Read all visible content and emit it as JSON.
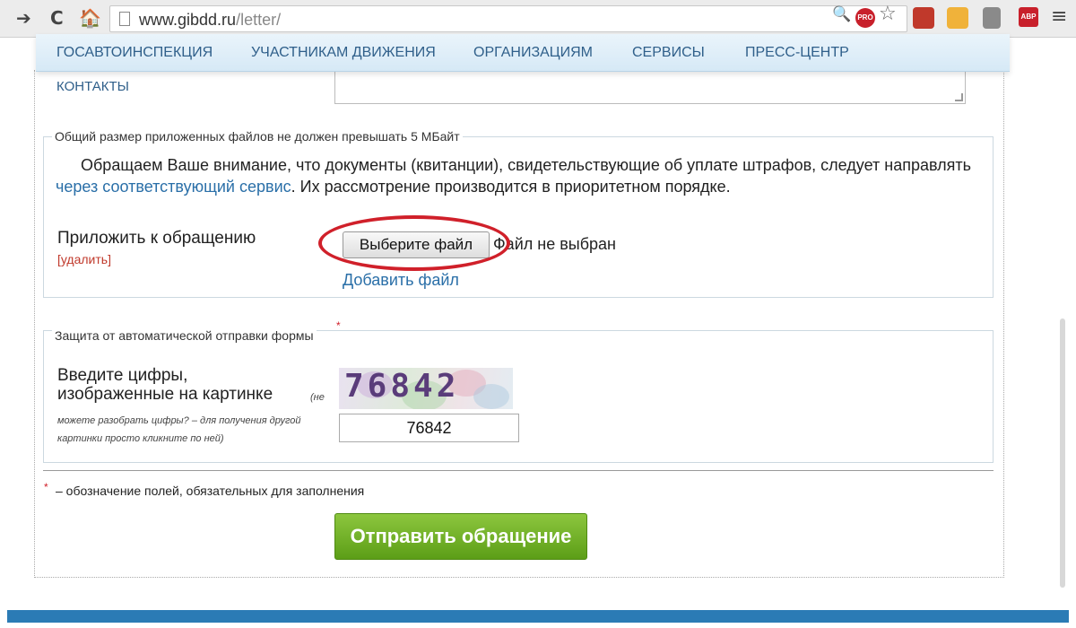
{
  "browser": {
    "back_glyph": "➔",
    "reload_glyph": "C",
    "home_glyph": "🏠",
    "url_host": "www.gibdd.ru",
    "url_path": "/letter/",
    "zoom_glyph": "🔍",
    "pro_badge": "PRO",
    "star_glyph": "☆",
    "abp_badge": "ABP",
    "menu_glyph": "≡"
  },
  "main_menu": {
    "items": [
      "ГОСАВТОИНСПЕКЦИЯ",
      "УЧАСТНИКАМ ДВИЖЕНИЯ",
      "ОРГАНИЗАЦИЯМ",
      "СЕРВИСЫ",
      "ПРЕСС-ЦЕНТР"
    ],
    "sub_item": "КОНТАКТЫ"
  },
  "attachments": {
    "legend": "Общий размер приложенных файлов не должен превышать 5 МБайт",
    "notice_before": "Обращаем Ваше внимание, что документы (квитанции), свидетельствующие об уплате штрафов, следует направлять ",
    "notice_link": "через соответствующий сервис",
    "notice_after": ". Их рассмотрение производится в приоритетном порядке.",
    "label": "Приложить к обращению",
    "delete_link": "[удалить]",
    "choose_button": "Выберите файл",
    "file_status": "Файл не выбран",
    "add_file_link": "Добавить файл"
  },
  "captcha": {
    "legend": "Защита от автоматической отправки формы",
    "required_star": "*",
    "label_line1": "Введите цифры,",
    "label_line2": "изображенные на картинке",
    "hint_inline": "(не",
    "hint": "можете разобрать цифры? – для получения другой картинки просто кликните по ней)",
    "image_digits": "76842",
    "input_value": "76842"
  },
  "footer": {
    "required_star": "*",
    "required_note": " – обозначение полей, обязательных для заполнения",
    "submit_label": "Отправить обращение"
  },
  "colors": {
    "accent_red": "#d0202a",
    "link_blue": "#2a6fa8",
    "submit_green": "#6fae22"
  }
}
